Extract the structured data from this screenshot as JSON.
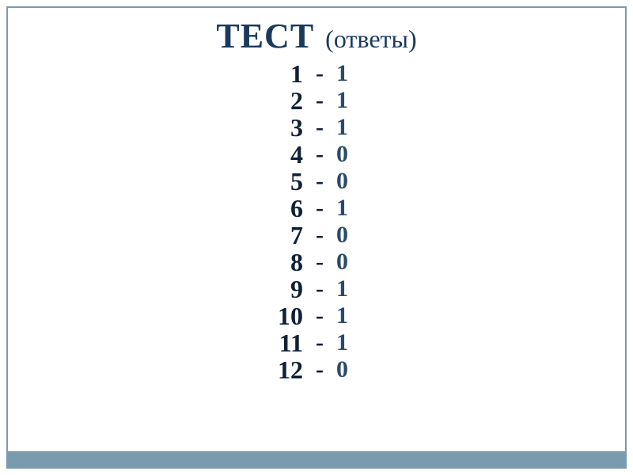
{
  "heading": {
    "main": "ТЕСТ",
    "sub": "(ответы)"
  },
  "answers": [
    {
      "num": "1",
      "dash": "-",
      "val": "1"
    },
    {
      "num": "2",
      "dash": "-",
      "val": "1"
    },
    {
      "num": "3",
      "dash": "-",
      "val": "1"
    },
    {
      "num": "4",
      "dash": "-",
      "val": "0"
    },
    {
      "num": "5",
      "dash": "-",
      "val": "0"
    },
    {
      "num": "6",
      "dash": "-",
      "val": "1"
    },
    {
      "num": "7",
      "dash": "-",
      "val": "0"
    },
    {
      "num": "8",
      "dash": "-",
      "val": "0"
    },
    {
      "num": "9",
      "dash": "-",
      "val": "1"
    },
    {
      "num": "10",
      "dash": "-",
      "val": "1"
    },
    {
      "num": "11",
      "dash": "-",
      "val": "1"
    },
    {
      "num": "12",
      "dash": "-",
      "val": "0"
    }
  ]
}
